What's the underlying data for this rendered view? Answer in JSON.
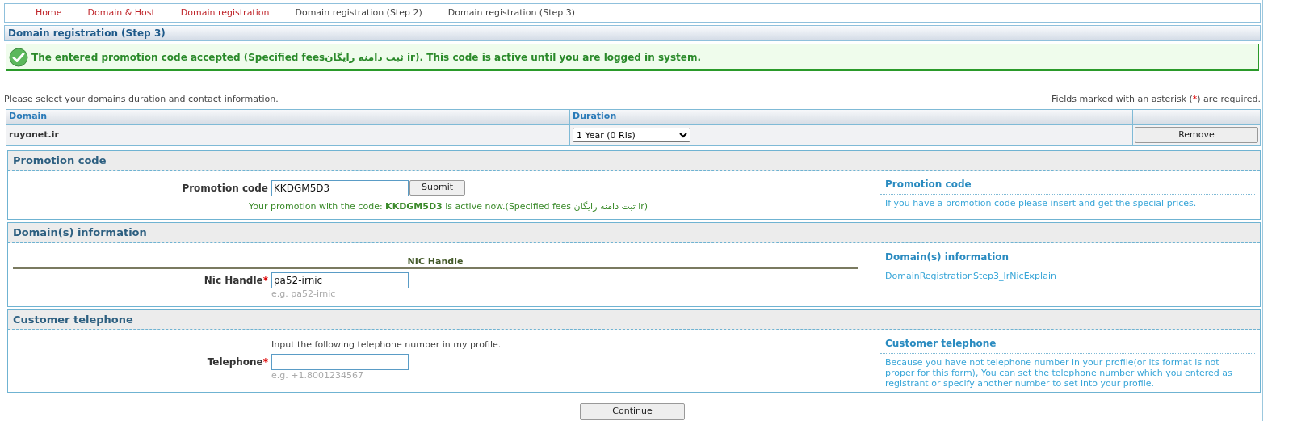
{
  "nav": [
    {
      "label": "Home",
      "link": true
    },
    {
      "label": "Domain & Host",
      "link": true
    },
    {
      "label": "Domain registration",
      "link": true
    },
    {
      "label": "Domain registration (Step 2)",
      "link": false
    },
    {
      "label": "Domain registration (Step 3)",
      "link": false
    }
  ],
  "page_title": "Domain registration (Step 3)",
  "success_message": "The entered promotion code accepted (Specified feesثبت دامنه رایگان ir). This code is active until you are logged in system.",
  "intro": "Please select your domains duration and contact information.",
  "required_note": {
    "before": "Fields marked with an asterisk (",
    "mark": "*",
    "after": ") are required."
  },
  "domains_table": {
    "columns": [
      "Domain",
      "Duration"
    ],
    "rows": [
      {
        "domain": "ruyonet.ir",
        "duration": "1 Year (0 Rls)",
        "action": "Remove"
      }
    ]
  },
  "sections": [
    {
      "title": "Promotion code",
      "field": {
        "label": "Promotion code",
        "value": "KKDGM5D3"
      },
      "button": "Submit",
      "status": "Your promotion with the code: **KKDGM5D3** is active now.(Specified fees ثبت دامنه رایگان ir)",
      "help": {
        "title": "Promotion code",
        "text": "If you have a promotion code please insert and get the special prices."
      }
    },
    {
      "title": "Domain(s) information",
      "subheading": "NIC Handle",
      "field": {
        "label": "Nic Handle",
        "required_mark": "*",
        "value": "pa52-irnic",
        "hint": "e.g. pa52-irnic"
      },
      "help": {
        "title": "Domain(s) information",
        "text": "DomainRegistrationStep3_IrNicExplain"
      }
    },
    {
      "title": "Customer telephone",
      "note": "Input the following telephone number in my profile.",
      "field": {
        "label": "Telephone",
        "required_mark": "*",
        "hint": "e.g. +1.8001234567"
      },
      "help": {
        "title": "Customer telephone",
        "text": "Because you have not telephone number in your profile(or its format is not proper for this form), You can set the telephone number which you entered as registrant or specify another number to set into your profile."
      }
    }
  ],
  "continue_button": "Continue"
}
